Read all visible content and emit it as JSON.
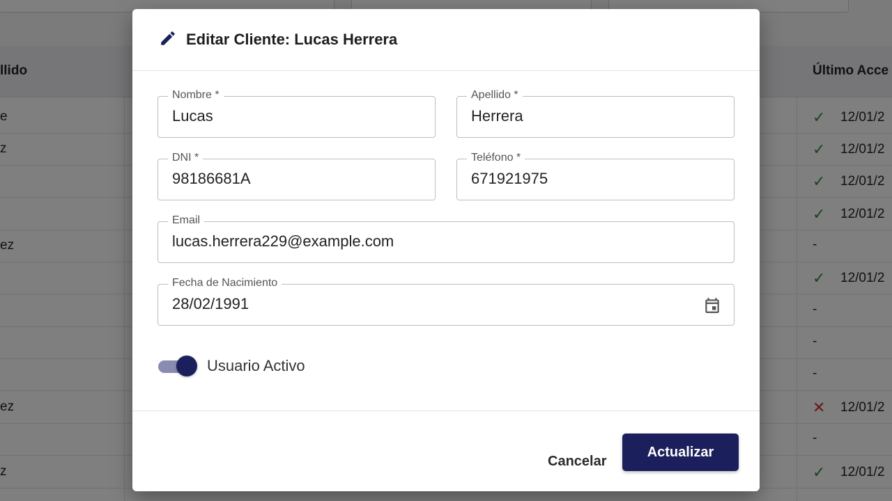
{
  "background": {
    "col_left_header": "llido",
    "col_right_header": "Último Acce",
    "rows": [
      {
        "left": "e",
        "status": "ok",
        "date": "12/01/2"
      },
      {
        "left": "z",
        "status": "ok",
        "date": "12/01/2"
      },
      {
        "left": "",
        "status": "ok",
        "date": "12/01/2"
      },
      {
        "left": "",
        "status": "ok",
        "date": "12/01/2"
      },
      {
        "left": "ez",
        "status": "none",
        "date": "-"
      },
      {
        "left": "",
        "status": "ok",
        "date": "12/01/2"
      },
      {
        "left": "",
        "status": "none",
        "date": "-"
      },
      {
        "left": "",
        "status": "none",
        "date": "-"
      },
      {
        "left": "",
        "status": "none",
        "date": "-"
      },
      {
        "left": "ez",
        "status": "bad",
        "date": "12/01/2"
      },
      {
        "left": "",
        "status": "none",
        "date": "-"
      },
      {
        "left": "z",
        "status": "ok",
        "date": "12/01/2"
      }
    ]
  },
  "dialog": {
    "title": "Editar Cliente: Lucas Herrera",
    "title_icon": "pencil-icon",
    "fields": {
      "nombre": {
        "label": "Nombre *",
        "value": "Lucas"
      },
      "apellido": {
        "label": "Apellido *",
        "value": "Herrera"
      },
      "dni": {
        "label": "DNI *",
        "value": "98186681A"
      },
      "telefono": {
        "label": "Teléfono *",
        "value": "671921975"
      },
      "email": {
        "label": "Email",
        "value": "lucas.herrera229@example.com"
      },
      "fecha": {
        "label": "Fecha de Nacimiento",
        "value": "28/02/1991",
        "icon": "calendar-icon"
      }
    },
    "toggle": {
      "label": "Usuario Activo",
      "checked": true
    },
    "buttons": {
      "cancel": "Cancelar",
      "update": "Actualizar"
    }
  },
  "colors": {
    "primary": "#1b1f5c",
    "ok": "#2e8b3d",
    "error": "#d32f2f"
  }
}
